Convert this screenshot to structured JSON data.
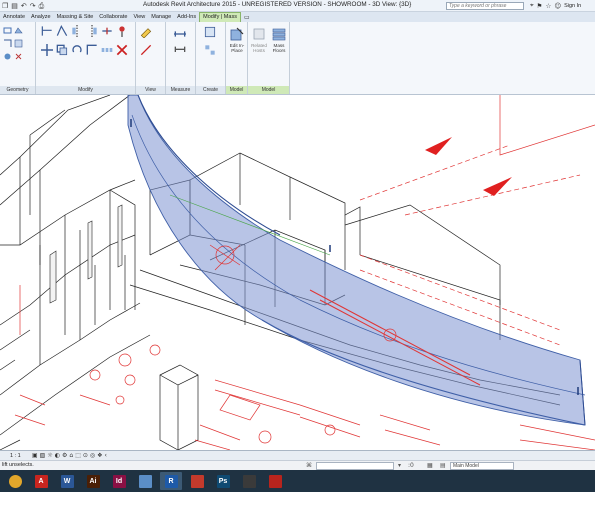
{
  "titlebar": {
    "title": "Autodesk Revit Architecture 2015 -  UNREGISTERED VERSION -    SHOWROOM - 3D View: {3D}",
    "help_search_placeholder": "Type a keyword or phrase",
    "sign_in": "Sign In",
    "quick_access": [
      "open-icon",
      "save-icon",
      "undo-icon",
      "redo-icon",
      "print-icon"
    ]
  },
  "ribbon": {
    "tabs": [
      {
        "label": "Annotate",
        "active": false
      },
      {
        "label": "Analyze",
        "active": false
      },
      {
        "label": "Massing & Site",
        "active": false
      },
      {
        "label": "Collaborate",
        "active": false
      },
      {
        "label": "View",
        "active": false
      },
      {
        "label": "Manage",
        "active": false
      },
      {
        "label": "Add-Ins",
        "active": false
      },
      {
        "label": "Modify | Mass",
        "active": true
      }
    ],
    "panels": {
      "geometry": "Geometry",
      "modify": "Modify",
      "view": "View",
      "measure": "Measure",
      "create": "Create",
      "model_left": "Model",
      "model_right": "Model"
    },
    "buttons": {
      "edit_in_place": "Edit In-Place",
      "related_hosts": "Related Hosts",
      "mass_floors": "Mass Floors"
    }
  },
  "viewbar": {
    "scale": "1 : 1"
  },
  "statusbar": {
    "text": "Left to select; TAB for alternates; CTRL adds; SHIFT unselects.",
    "visible_text": "lift unselects.",
    "model_selector": "Main Model",
    "coordinate_value": ":0"
  },
  "taskbar": {
    "apps": [
      {
        "name": "chrome-icon",
        "label": "",
        "color": "#e2a72b"
      },
      {
        "name": "acrobat-icon",
        "label": "A",
        "color": "#c8251f"
      },
      {
        "name": "word-icon",
        "label": "W",
        "color": "#2b5797"
      },
      {
        "name": "illustrator-icon",
        "label": "Ai",
        "color": "#4a1f06"
      },
      {
        "name": "indesign-icon",
        "label": "Id",
        "color": "#8a1044"
      },
      {
        "name": "paint-icon",
        "label": "",
        "color": "#5b8ec7"
      },
      {
        "name": "revit-icon",
        "label": "R",
        "color": "#1e5aa8"
      },
      {
        "name": "sketchup-icon",
        "label": "",
        "color": "#c43a2c"
      },
      {
        "name": "photoshop-icon",
        "label": "Ps",
        "color": "#0f4a72"
      },
      {
        "name": "gimp-icon",
        "label": "",
        "color": "#3a3a3a"
      },
      {
        "name": "acrobat-reader-icon",
        "label": "",
        "color": "#b8241d"
      }
    ]
  },
  "colors": {
    "mass_fill": "#7d93d1",
    "mass_edge": "#3f5fa7",
    "ribbon_context": "#cfe9b7",
    "red_lines": "#e03535",
    "taskbar": "#1f3242"
  }
}
